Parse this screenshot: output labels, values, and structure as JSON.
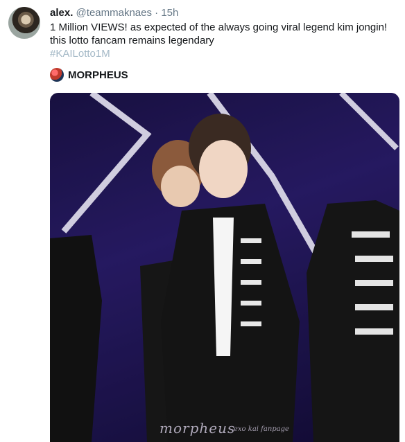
{
  "tweet": {
    "name": "alex.",
    "handle": "@teammaknaes",
    "separator": "·",
    "time": "15h",
    "text": "1 Million VIEWS! as expected of the always going viral legend kim jongin! this lotto fancam remains legendary",
    "hashtag": "#KAILotto1M"
  },
  "quoted": {
    "name": "MORPHEUS"
  },
  "media": {
    "watermark": "morpheus",
    "watermark_sub": "exo kai fanpage"
  }
}
